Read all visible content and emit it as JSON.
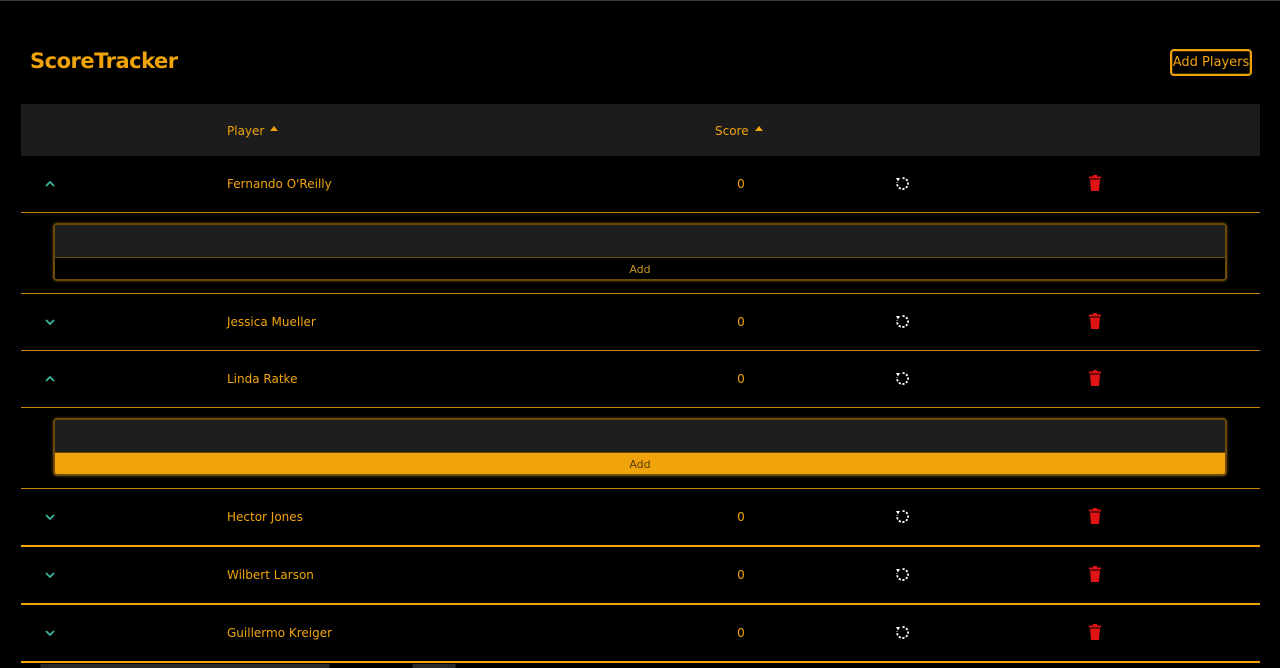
{
  "app": {
    "title": "ScoreTracker",
    "add_players_label": "Add Players"
  },
  "table": {
    "columns": {
      "player": "Player",
      "score": "Score"
    },
    "rows": [
      {
        "name": "Fernando O'Reilly",
        "score": "0",
        "expanded": true
      },
      {
        "name": "Jessica Mueller",
        "score": "0",
        "expanded": false
      },
      {
        "name": "Linda Ratke",
        "score": "0",
        "expanded": true
      },
      {
        "name": "Hector Jones",
        "score": "0",
        "expanded": false
      },
      {
        "name": "Wilbert Larson",
        "score": "0",
        "expanded": false
      },
      {
        "name": "Guillermo Kreiger",
        "score": "0",
        "expanded": false
      }
    ],
    "expanders": [
      {
        "input_value": "",
        "add_label": "Add",
        "add_active": false
      },
      {
        "input_value": "",
        "add_label": "Add",
        "add_active": true
      }
    ]
  },
  "icons": {
    "expand": "chevron-down-icon",
    "collapse": "chevron-up-icon",
    "reset": "reset-icon",
    "delete": "trash-icon"
  },
  "colors": {
    "accent": "#f0a30a",
    "expand_chevron": "#3cb4a0",
    "delete": "#e01414",
    "header_bg": "#1c1c1c"
  }
}
